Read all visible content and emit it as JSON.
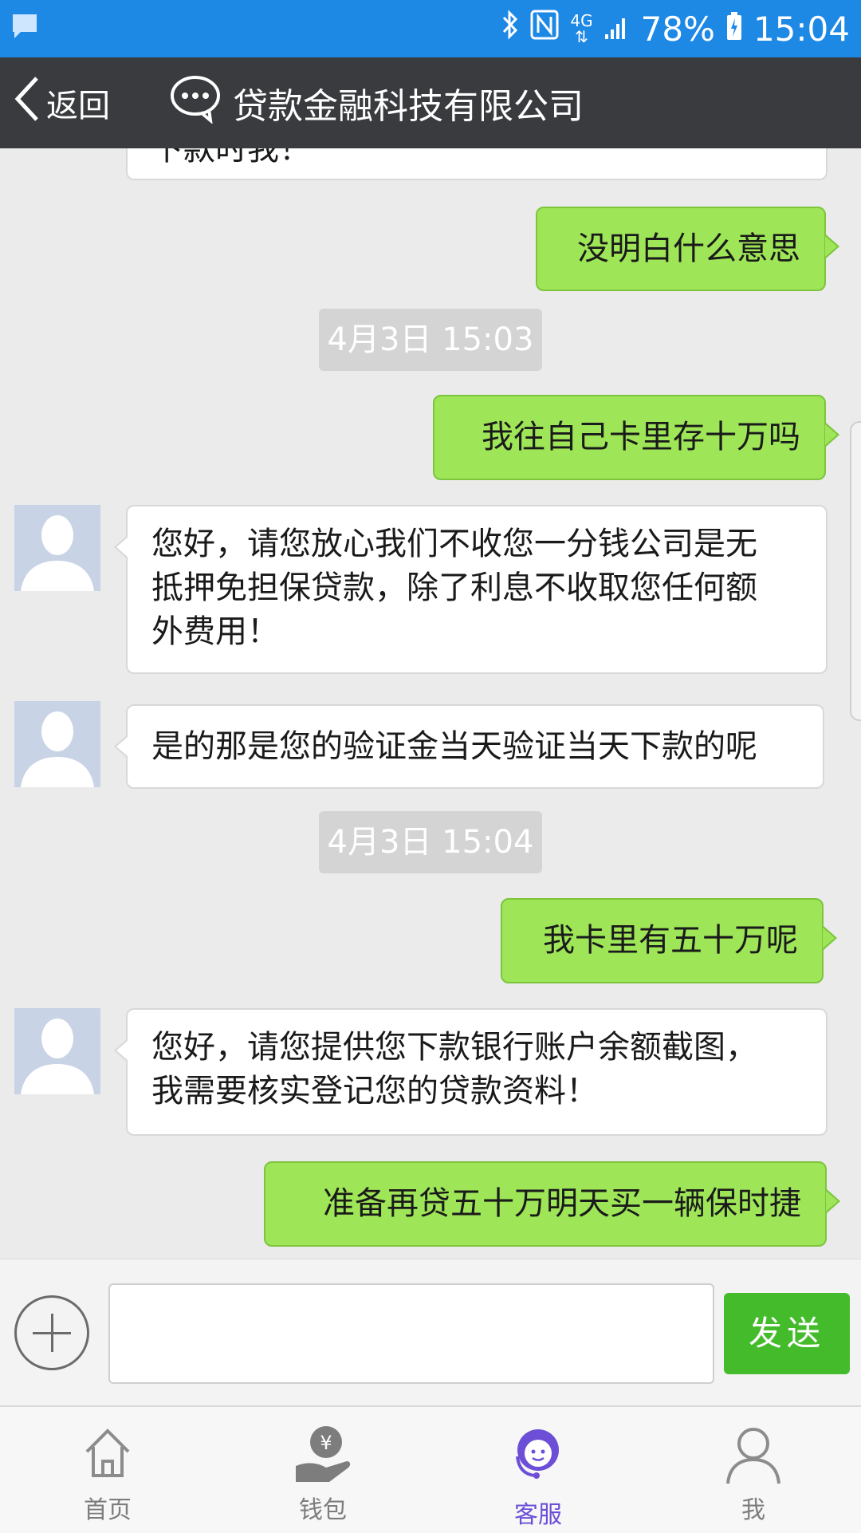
{
  "status_bar": {
    "network": "4G",
    "battery": "78%",
    "time": "15:04",
    "icons": [
      "chat-notification-icon",
      "bluetooth-icon",
      "nfc-icon",
      "signal-icon",
      "battery-icon"
    ]
  },
  "header": {
    "back_label": "返回",
    "title": "贷款金融科技有限公司"
  },
  "messages": [
    {
      "side": "left",
      "text": "下款时我！"
    },
    {
      "side": "right",
      "text": "没明白什么意思"
    },
    {
      "type": "timestamp",
      "text": "4月3日 15:03"
    },
    {
      "side": "right",
      "text": "我往自己卡里存十万吗"
    },
    {
      "side": "left",
      "lines": [
        "您好，请您放心我们不收您一分钱公司是无",
        "抵押免担保贷款，除了利息不收取您任何额",
        "外费用！"
      ]
    },
    {
      "side": "left",
      "text": "是的那是您的验证金当天验证当天下款的呢"
    },
    {
      "type": "timestamp",
      "text": "4月3日 15:04"
    },
    {
      "side": "right",
      "text": "我卡里有五十万呢"
    },
    {
      "side": "left",
      "lines": [
        "您好，请您提供您下款银行账户余额截图，",
        "我需要核实登记您的贷款资料！"
      ]
    },
    {
      "side": "right",
      "text": "准备再贷五十万明天买一辆保时捷"
    }
  ],
  "input": {
    "value": "",
    "send_label": "发送"
  },
  "nav": {
    "items": [
      {
        "label": "首页",
        "icon": "home-icon"
      },
      {
        "label": "钱包",
        "icon": "wallet-icon"
      },
      {
        "label": "客服",
        "icon": "customer-service-icon",
        "active": true
      },
      {
        "label": "我",
        "icon": "user-icon"
      }
    ]
  },
  "colors": {
    "status_bar": "#1e88e5",
    "title_bar": "#3a3b3f",
    "sent_bubble": "#9ee658",
    "send_button": "#44bb2b",
    "active_nav": "#6c4fd6"
  }
}
